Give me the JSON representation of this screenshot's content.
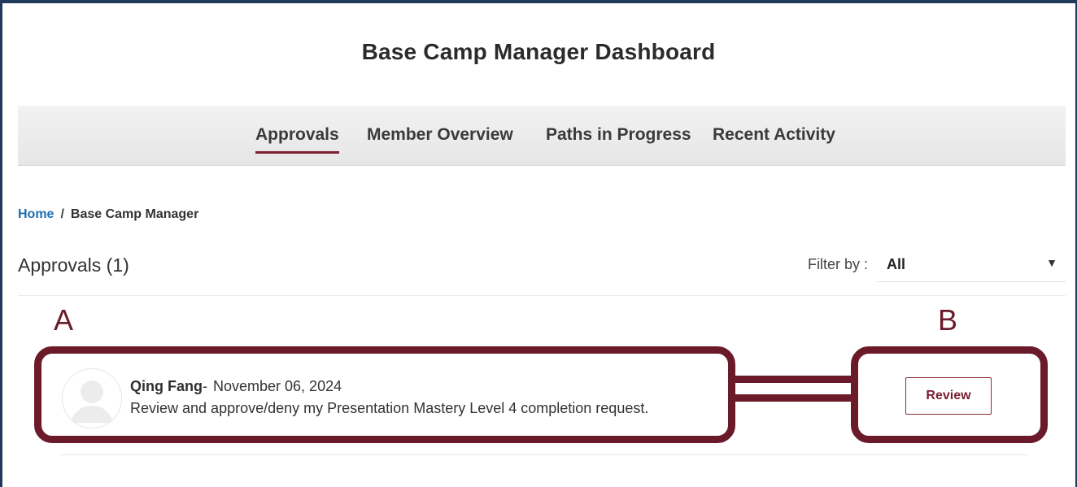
{
  "page": {
    "title": "Base Camp Manager Dashboard"
  },
  "tabs": [
    {
      "label": "Approvals",
      "active": true
    },
    {
      "label": "Member Overview",
      "active": false
    },
    {
      "label": "Paths in Progress",
      "active": false
    },
    {
      "label": "Recent Activity",
      "active": false
    }
  ],
  "breadcrumb": {
    "home": "Home",
    "separator": "/",
    "current": "Base Camp Manager"
  },
  "approvals": {
    "heading": "Approvals (1)",
    "filter_label": "Filter by :",
    "filter_value": "All",
    "items": [
      {
        "name": "Qing Fang",
        "separator": "-",
        "date": "November 06, 2024",
        "message": "Review and approve/deny my Presentation Mastery Level 4 completion request.",
        "action_label": "Review",
        "avatar_icon": "user-placeholder-icon"
      }
    ]
  },
  "annotations": {
    "label_a": "A",
    "label_b": "B",
    "color": "#6b1a2a"
  },
  "colors": {
    "accent": "#7b1e2e",
    "link": "#1f6fb2",
    "frame": "#1f3a5a"
  }
}
